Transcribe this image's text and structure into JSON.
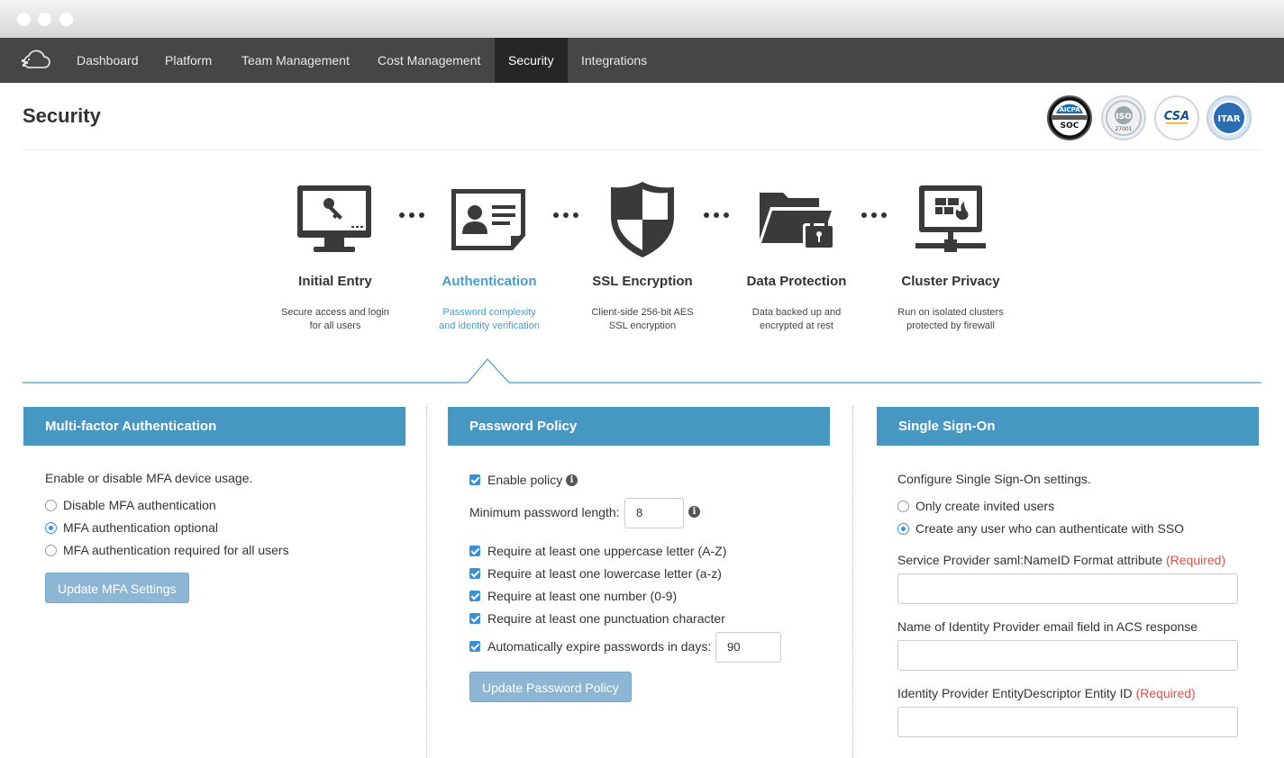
{
  "nav": {
    "items": [
      {
        "label": "Dashboard"
      },
      {
        "label": "Platform"
      },
      {
        "label": "Team Management"
      },
      {
        "label": "Cost Management"
      },
      {
        "label": "Security"
      },
      {
        "label": "Integrations"
      }
    ]
  },
  "page": {
    "title": "Security",
    "badges": [
      "AICPA SOC",
      "ISO 27001",
      "CSA",
      "ITAR"
    ]
  },
  "steps": [
    {
      "title": "Initial Entry",
      "desc1": "Secure access and login",
      "desc2": "for all users",
      "icon": "monitor-key-icon"
    },
    {
      "title": "Authentication",
      "desc1": "Password complexity",
      "desc2": "and identity verification",
      "icon": "id-card-icon"
    },
    {
      "title": "SSL Encryption",
      "desc1": "Client-side 256-bit AES",
      "desc2": "SSL encryption",
      "icon": "shield-icon"
    },
    {
      "title": "Data Protection",
      "desc1": "Data backed up and",
      "desc2": "encrypted at rest",
      "icon": "folder-lock-icon"
    },
    {
      "title": "Cluster Privacy",
      "desc1": "Run on isolated clusters",
      "desc2": "protected by firewall",
      "icon": "network-firewall-icon"
    }
  ],
  "mfa": {
    "header": "Multi-factor Authentication",
    "intro": "Enable or disable MFA device usage.",
    "options": [
      {
        "label": "Disable MFA authentication",
        "selected": false
      },
      {
        "label": "MFA authentication optional",
        "selected": true
      },
      {
        "label": "MFA authentication required for all users",
        "selected": false
      }
    ],
    "button": "Update MFA Settings"
  },
  "password": {
    "header": "Password Policy",
    "enable_label": "Enable policy",
    "min_length_label": "Minimum password length:",
    "min_length_value": "8",
    "rules": [
      "Require at least one uppercase letter (A-Z)",
      "Require at least one lowercase letter (a-z)",
      "Require at least one number (0-9)",
      "Require at least one punctuation character"
    ],
    "expire_label": "Automatically expire passwords in days:",
    "expire_value": "90",
    "button": "Update Password Policy"
  },
  "sso": {
    "header": "Single Sign-On",
    "intro": "Configure Single Sign-On settings.",
    "options": [
      {
        "label": "Only create invited users",
        "selected": false
      },
      {
        "label": "Create any user who can authenticate with SSO",
        "selected": true
      }
    ],
    "field1_label": "Service Provider saml:NameID Format attribute",
    "field2_label": "Name of Identity Provider email field in ACS response",
    "field3_label": "Identity Provider EntityDescriptor Entity ID",
    "required_tag": "(Required)",
    "field1_value": "",
    "field2_value": "",
    "field3_value": ""
  },
  "colors": {
    "accent": "#4698c3",
    "nav_bg": "#464646",
    "nav_active": "#262626",
    "required": "#d9534f",
    "button_disabled": "#8cb6d3"
  }
}
